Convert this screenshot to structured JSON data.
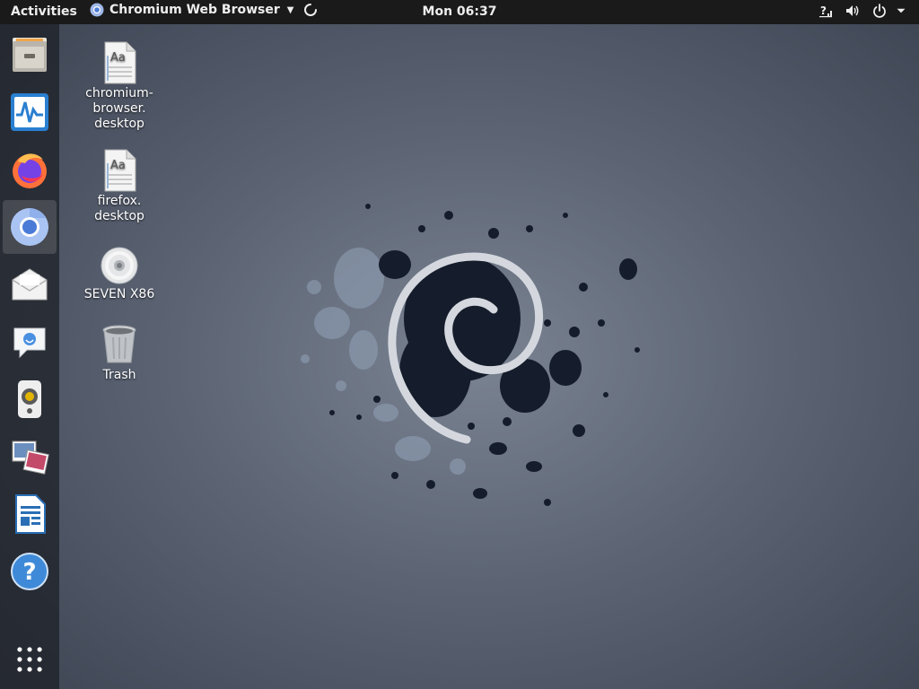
{
  "topbar": {
    "activities_label": "Activities",
    "app_name": "Chromium Web Browser",
    "clock": "Mon 06:37",
    "tray_icons": [
      "network-question-icon",
      "volume-icon",
      "power-icon",
      "chevron-down-icon"
    ]
  },
  "dock": {
    "items": [
      {
        "icon": "file-cabinet-icon",
        "name": "Files"
      },
      {
        "icon": "system-monitor-icon",
        "name": "System Monitor"
      },
      {
        "icon": "firefox-icon",
        "name": "Firefox"
      },
      {
        "icon": "chromium-icon",
        "name": "Chromium Web Browser",
        "active": true
      },
      {
        "icon": "mail-icon",
        "name": "Mail"
      },
      {
        "icon": "chat-icon",
        "name": "Chat"
      },
      {
        "icon": "speaker-icon",
        "name": "Music"
      },
      {
        "icon": "image-viewer-icon",
        "name": "Image Viewer"
      },
      {
        "icon": "document-icon",
        "name": "Writer"
      },
      {
        "icon": "help-icon",
        "name": "Help"
      },
      {
        "icon": "app-grid-icon",
        "name": "Show Applications"
      }
    ]
  },
  "desktop": {
    "icons": [
      {
        "label": "chromium-\nbrowser.\ndesktop",
        "icon": "text-file-icon"
      },
      {
        "label": "firefox.\ndesktop",
        "icon": "text-file-icon"
      },
      {
        "label": "SEVEN X86",
        "icon": "disc-icon"
      },
      {
        "label": "Trash",
        "icon": "trash-icon"
      }
    ]
  },
  "wallpaper": {
    "icon": "debian-swirl-icon"
  }
}
